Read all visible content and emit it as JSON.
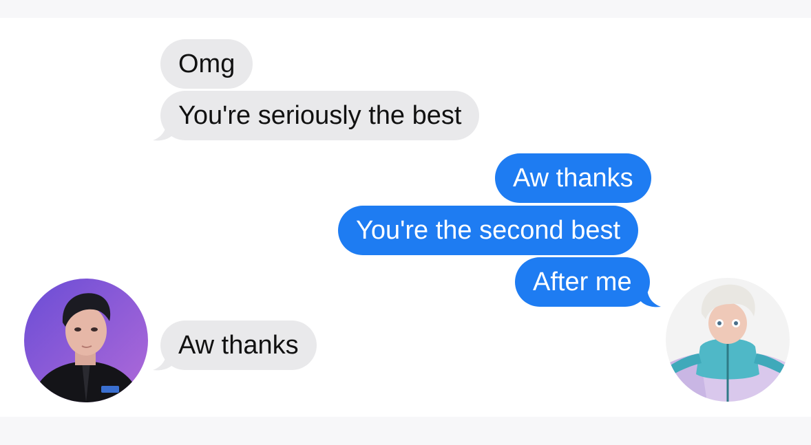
{
  "conversation": {
    "messages": [
      {
        "sender": "them",
        "text": "Omg"
      },
      {
        "sender": "them",
        "text": "You're seriously the best"
      },
      {
        "sender": "me",
        "text": "Aw thanks"
      },
      {
        "sender": "me",
        "text": "You're the second best"
      },
      {
        "sender": "me",
        "text": "After me"
      },
      {
        "sender": "them",
        "text": "Aw thanks"
      }
    ]
  },
  "colors": {
    "incoming_bubble": "#e9e9eb",
    "outgoing_bubble": "#1e7cf2",
    "incoming_text": "#111111",
    "outgoing_text": "#ffffff"
  }
}
